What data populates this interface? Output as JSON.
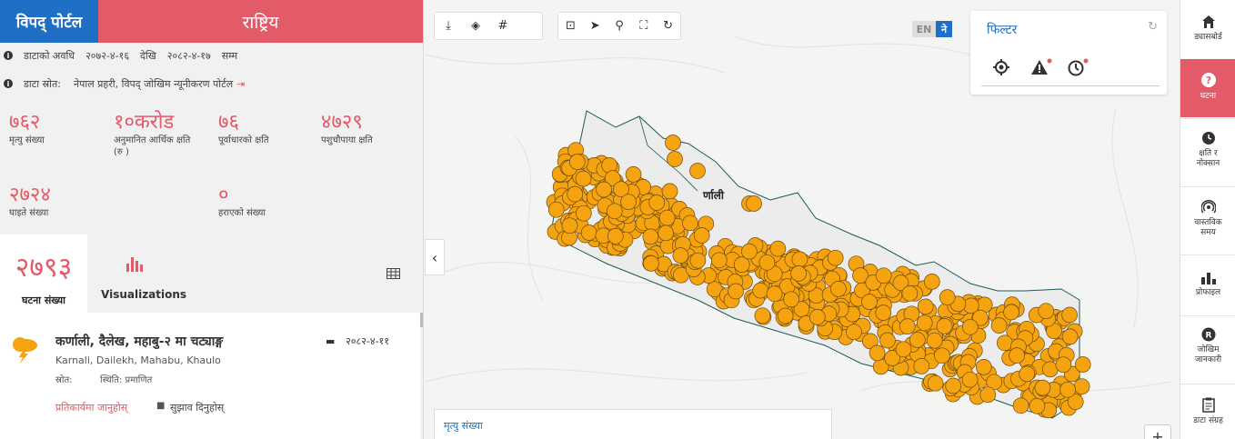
{
  "header": {
    "brand": "विपद् पोर्टल",
    "region": "राष्ट्रिय"
  },
  "info": {
    "period_label": "डाटाको अवधि",
    "period_from": "२०७२-४-१६",
    "period_from_word": "देखि",
    "period_to": "२०८२-४-१७",
    "period_to_word": "सम्म",
    "source_label": "डाटा स्रोत:",
    "source_value": "नेपाल प्रहरी, विपद् जोखिम न्यूनीकरण पोर्टल"
  },
  "stats": [
    {
      "value": "७६२",
      "label": "मृत्यु संख्या"
    },
    {
      "value": "१०करोड",
      "label": "अनुमानित आर्थिक क्षति (रु )"
    },
    {
      "value": "७६",
      "label": "पूर्वाधारको क्षति"
    },
    {
      "value": "४७२९",
      "label": "पशुचौपाया क्षति"
    },
    {
      "value": "२७२४",
      "label": "घाइते संख्या"
    },
    {
      "value": "०",
      "label": "हराएको संख्या"
    }
  ],
  "tabs": {
    "count_value": "२७९३",
    "count_label": "घटना संख्या",
    "viz_label": "Visualizations"
  },
  "incident": {
    "title": "कर्णाली, दैलेख, महाबु-२ मा चट्याङ्ग",
    "date": "२०८२-४-११",
    "subtitle": "Karnali, Dailekh, Mahabu, Khaulo",
    "source_label": "स्रोत:",
    "status_label": "स्थिति: प्रमाणित",
    "response_link": "प्रतिकार्यमा जानुहोस्",
    "suggest_label": "सुझाव दिनुहोस्"
  },
  "map": {
    "place_label": "र्णाली",
    "legend_title": "मृत्यु संख्या",
    "zoom_in": "+",
    "marker_color": "#f5a30f"
  },
  "lang": {
    "en": "EN",
    "ne": "ने"
  },
  "filter": {
    "title": "फिल्टर"
  },
  "nav": [
    {
      "label": "ड्यासबोर्ड",
      "icon": "home-icon"
    },
    {
      "label": "घटना",
      "icon": "question-icon",
      "active": true
    },
    {
      "label": "क्षति र नोक्सान",
      "icon": "clock-icon"
    },
    {
      "label": "वास्तविक समय",
      "icon": "realtime-icon"
    },
    {
      "label": "प्रोफाइल",
      "icon": "bar-chart-icon"
    },
    {
      "label": "जोखिम जानकारी",
      "icon": "risk-icon"
    },
    {
      "label": "डाटा संग्रह",
      "icon": "clipboard-icon"
    }
  ],
  "colors": {
    "accent": "#e35a68",
    "brand": "#1f6fc6",
    "marker": "#f5a30f"
  }
}
